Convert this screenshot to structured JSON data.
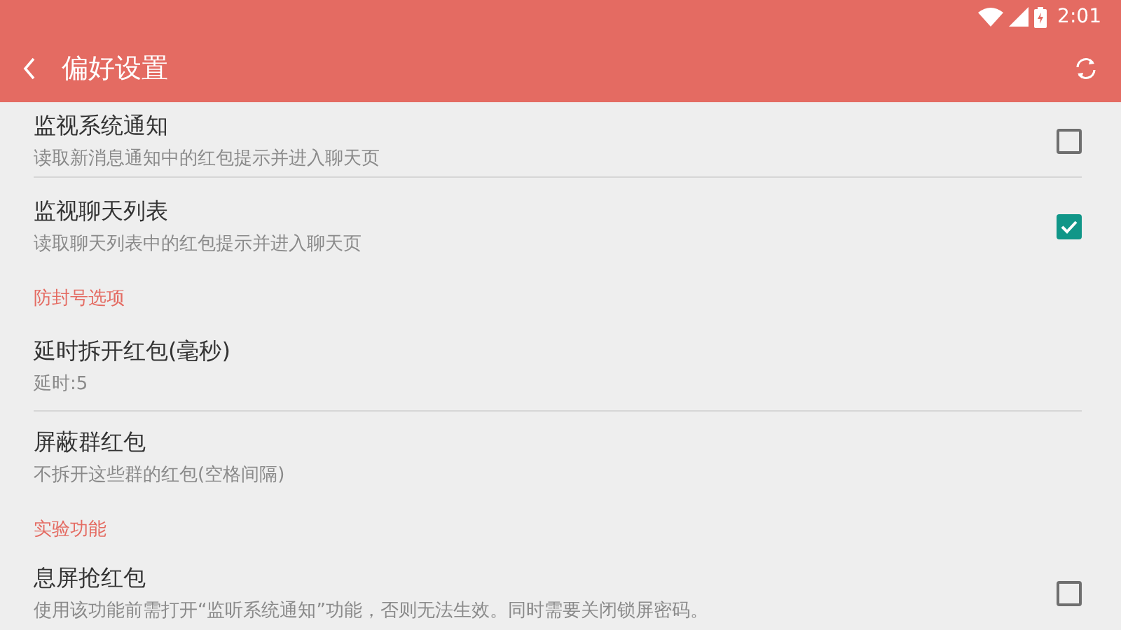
{
  "status_bar": {
    "time": "2:01"
  },
  "toolbar": {
    "title": "偏好设置"
  },
  "items": [
    {
      "kind": "checkbox",
      "title": "监视系统通知",
      "summary": "读取新消息通知中的红包提示并进入聊天页",
      "checked": false
    },
    {
      "kind": "checkbox",
      "title": "监视聊天列表",
      "summary": "读取聊天列表中的红包提示并进入聊天页",
      "checked": true
    },
    {
      "kind": "category",
      "title": "防封号选项"
    },
    {
      "kind": "text",
      "title": "延时拆开红包(毫秒)",
      "summary": "延时:5"
    },
    {
      "kind": "text",
      "title": "屏蔽群红包",
      "summary": "不拆开这些群的红包(空格间隔)"
    },
    {
      "kind": "category",
      "title": "实验功能"
    },
    {
      "kind": "checkbox",
      "title": "息屏抢红包",
      "summary": "使用该功能前需打开“监听系统通知”功能，否则无法生效。同时需要关闭锁屏密码。",
      "checked": false
    }
  ]
}
